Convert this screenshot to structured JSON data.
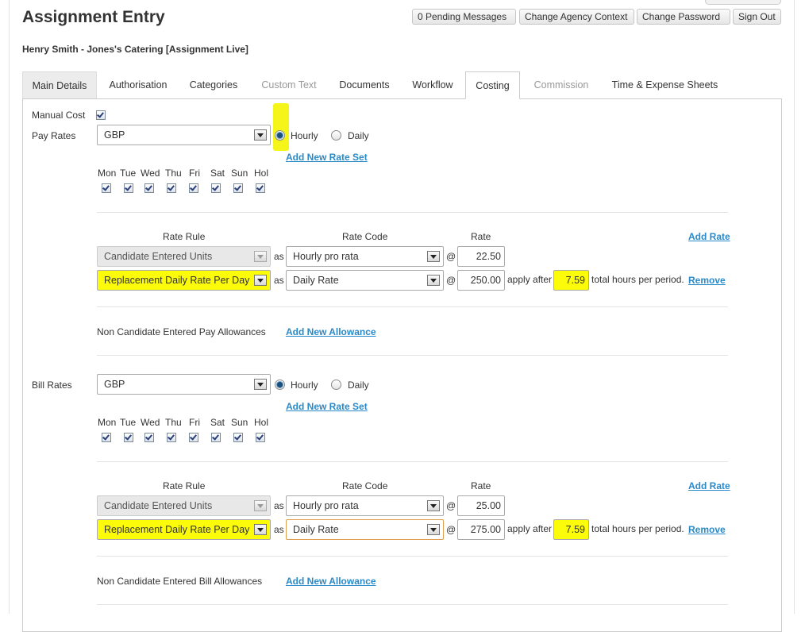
{
  "page": {
    "title": "Assignment Entry",
    "subtitle": "Henry Smith - Jones's Catering [Assignment Live]"
  },
  "header_buttons": [
    "0 Pending Messages",
    "Change Agency Context",
    "Change Password",
    "Sign Out"
  ],
  "tabs": [
    {
      "label": "Main Details",
      "state": "normal"
    },
    {
      "label": "Authorisation",
      "state": "normal"
    },
    {
      "label": "Categories",
      "state": "normal"
    },
    {
      "label": "Custom Text",
      "state": "disabled"
    },
    {
      "label": "Documents",
      "state": "normal"
    },
    {
      "label": "Workflow",
      "state": "normal"
    },
    {
      "label": "Costing",
      "state": "active"
    },
    {
      "label": "Commission",
      "state": "disabled"
    },
    {
      "label": "Time & Expense Sheets",
      "state": "normal"
    }
  ],
  "manual_cost": {
    "label": "Manual Cost",
    "checked": true
  },
  "days": [
    "Mon",
    "Tue",
    "Wed",
    "Thu",
    "Fri",
    "Sat",
    "Sun",
    "Hol"
  ],
  "rate_headers": {
    "rule": "Rate Rule",
    "code": "Rate Code",
    "rate": "Rate"
  },
  "common": {
    "as": "as",
    "at": "@",
    "apply_after": "apply after",
    "total_hours": "total hours per period.",
    "remove": "Remove",
    "add_rate": "Add Rate",
    "add_new_rate_set": "Add New Rate Set",
    "add_new_allowance": "Add New Allowance",
    "hourly": "Hourly",
    "daily": "Daily"
  },
  "pay_rates": {
    "label": "Pay Rates",
    "currency": "GBP",
    "period": "Hourly",
    "rows": [
      {
        "rule": "Candidate Entered Units",
        "code": "Hourly pro rata",
        "rate": "22.50"
      },
      {
        "rule": "Replacement Daily Rate Per Day",
        "code": "Daily Rate",
        "rate": "250.00",
        "apply_after": "7.59"
      }
    ],
    "allowances_label": "Non Candidate Entered Pay Allowances"
  },
  "bill_rates": {
    "label": "Bill Rates",
    "currency": "GBP",
    "period": "Hourly",
    "rows": [
      {
        "rule": "Candidate Entered Units",
        "code": "Hourly pro rata",
        "rate": "25.00"
      },
      {
        "rule": "Replacement Daily Rate Per Day",
        "code": "Daily Rate",
        "rate": "275.00",
        "apply_after": "7.59"
      }
    ],
    "allowances_label": "Non Candidate Entered Bill Allowances"
  },
  "colors": {
    "link": "#2a8ac9",
    "highlight": "#fbfb0a",
    "radio_selected": "#1b4f7a"
  }
}
